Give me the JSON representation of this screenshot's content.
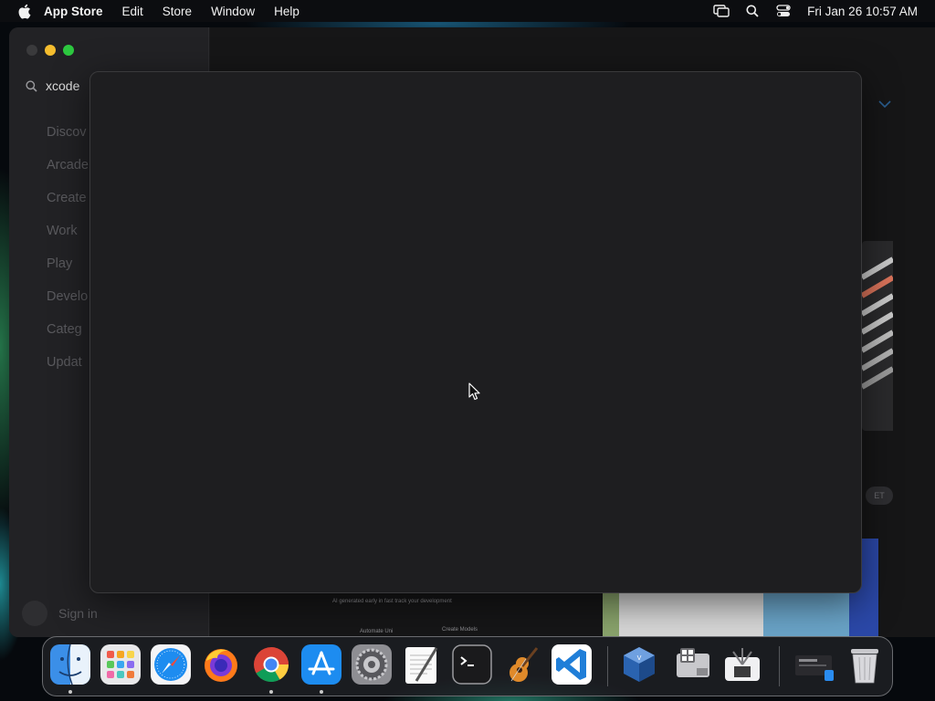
{
  "menubar": {
    "apple_icon": "apple-logo-icon",
    "app_name": "App Store",
    "menus": [
      "Edit",
      "Store",
      "Window",
      "Help"
    ],
    "status_icons": [
      "screen-mirroring-icon",
      "spotlight-search-icon",
      "control-center-icon"
    ],
    "clock": "Fri Jan 26  10:57 AM"
  },
  "app_window": {
    "search": {
      "value": "xcode",
      "icon": "search-icon"
    },
    "sidebar_items": [
      "Discov",
      "Arcade",
      "Create",
      "Work",
      "Play",
      "Develo",
      "Categ",
      "Updat"
    ],
    "signin_label": "Sign in",
    "content_snippets": {
      "get_fragment": "ET",
      "caption1": "AI generated early in fast track your development",
      "caption2": "Create Models",
      "caption3": "Automate Uni"
    }
  },
  "dock": {
    "items": [
      {
        "name": "Finder",
        "icon": "finder-icon",
        "running": true
      },
      {
        "name": "Launchpad",
        "icon": "launchpad-icon",
        "running": false
      },
      {
        "name": "Safari",
        "icon": "safari-icon",
        "running": false
      },
      {
        "name": "Firefox",
        "icon": "firefox-icon",
        "running": false
      },
      {
        "name": "Google Chrome",
        "icon": "chrome-icon",
        "running": true
      },
      {
        "name": "App Store",
        "icon": "app-store-icon",
        "running": true
      },
      {
        "name": "System Settings",
        "icon": "system-settings-icon",
        "running": false
      },
      {
        "name": "TextEdit",
        "icon": "textedit-icon",
        "running": false
      },
      {
        "name": "Terminal",
        "icon": "terminal-icon",
        "running": false
      },
      {
        "name": "GarageBand",
        "icon": "garageband-icon",
        "running": false
      },
      {
        "name": "Visual Studio Code",
        "icon": "vscode-icon",
        "running": false
      },
      {
        "name": "VirtualBox",
        "icon": "virtualbox-icon",
        "running": false
      },
      {
        "name": "Boot Camp Assistant",
        "icon": "bootcamp-icon",
        "running": false
      },
      {
        "name": "System Information",
        "icon": "system-information-icon",
        "running": false
      },
      {
        "name": "Downloads",
        "icon": "downloads-stack-icon",
        "running": false
      },
      {
        "name": "Trash",
        "icon": "trash-icon",
        "running": false
      }
    ]
  }
}
